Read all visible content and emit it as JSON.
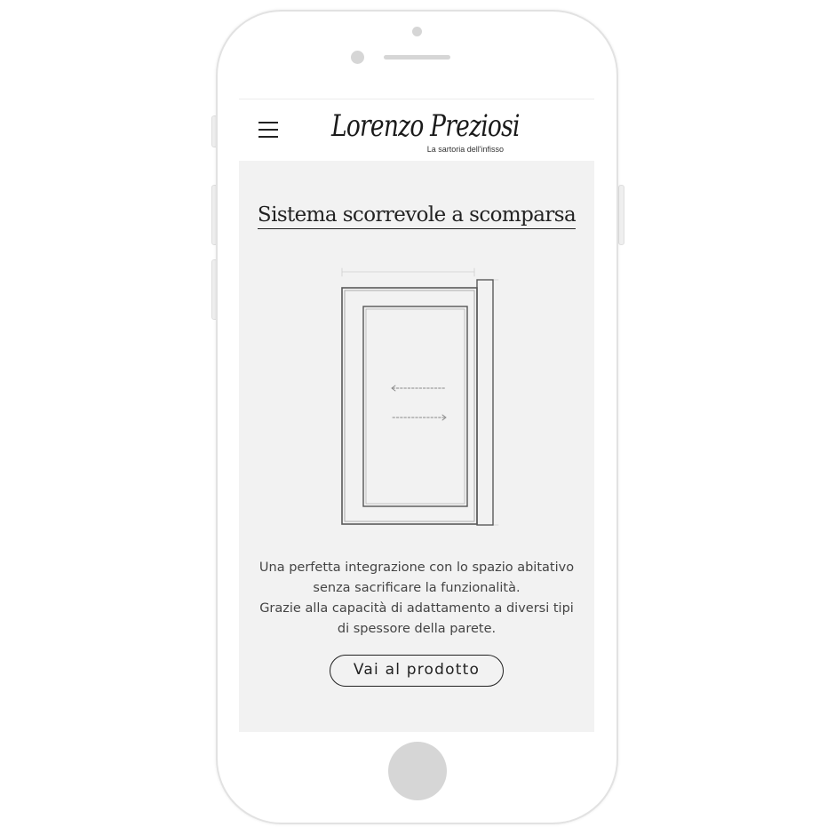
{
  "header": {
    "menu_icon": "hamburger-icon",
    "logo_text": "Lorenzo Preziosi",
    "logo_tagline": "La sartoria dell'infisso"
  },
  "section": {
    "title": "Sistema scorrevole a scomparsa",
    "description_lines": [
      "Una perfetta integrazione con lo spazio abitativo",
      "senza sacrificare la funzionalità.",
      "Grazie alla capacità di adattamento a diversi tipi",
      "di spessore della parete."
    ],
    "cta_label": "Vai al prodotto",
    "illustration": "sliding-pocket-door-sketch"
  },
  "colors": {
    "screen_background": "#f2f2f2",
    "text": "#222222",
    "device_frame": "#ffffff",
    "device_accent": "#d6d6d6"
  }
}
